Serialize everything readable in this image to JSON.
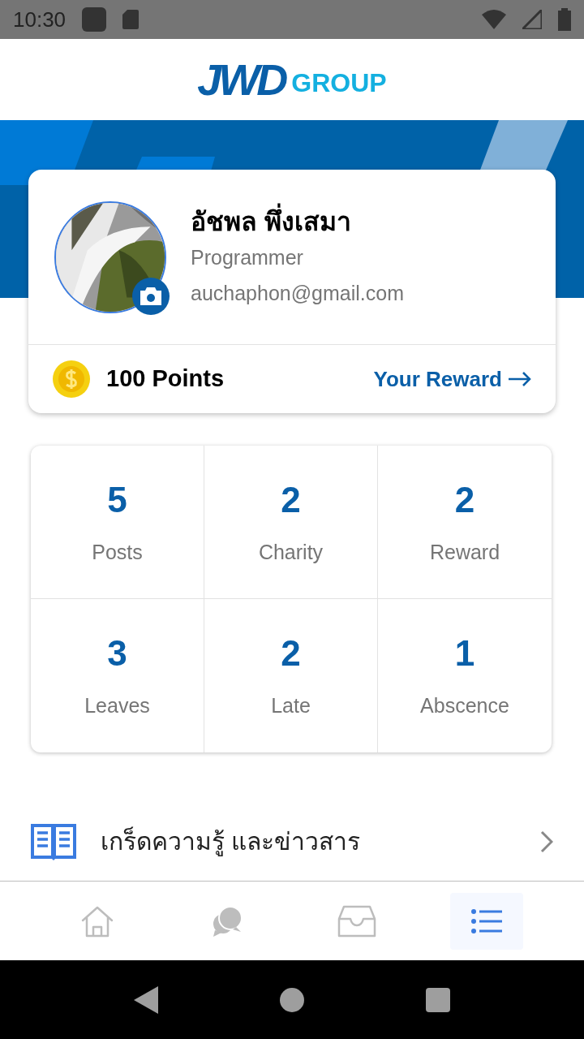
{
  "status_bar": {
    "time": "10:30"
  },
  "logo": {
    "mark": "JWD",
    "word": "GROUP"
  },
  "profile": {
    "name": "อัชพล พึ่งเสมา",
    "role": "Programmer",
    "email": "auchaphon@gmail.com",
    "points": "100 Points",
    "reward_link": "Your Reward"
  },
  "stats": [
    {
      "value": "5",
      "label": "Posts"
    },
    {
      "value": "2",
      "label": "Charity"
    },
    {
      "value": "2",
      "label": "Reward"
    },
    {
      "value": "3",
      "label": "Leaves"
    },
    {
      "value": "2",
      "label": "Late"
    },
    {
      "value": "1",
      "label": "Abscence"
    }
  ],
  "menu": [
    {
      "label": "เกร็ดความรู้ และข่าวสาร"
    }
  ],
  "bottom_nav": [
    {
      "kind": "home",
      "selected": false
    },
    {
      "kind": "chat",
      "selected": false
    },
    {
      "kind": "inbox",
      "selected": false
    },
    {
      "kind": "list",
      "selected": true
    }
  ]
}
